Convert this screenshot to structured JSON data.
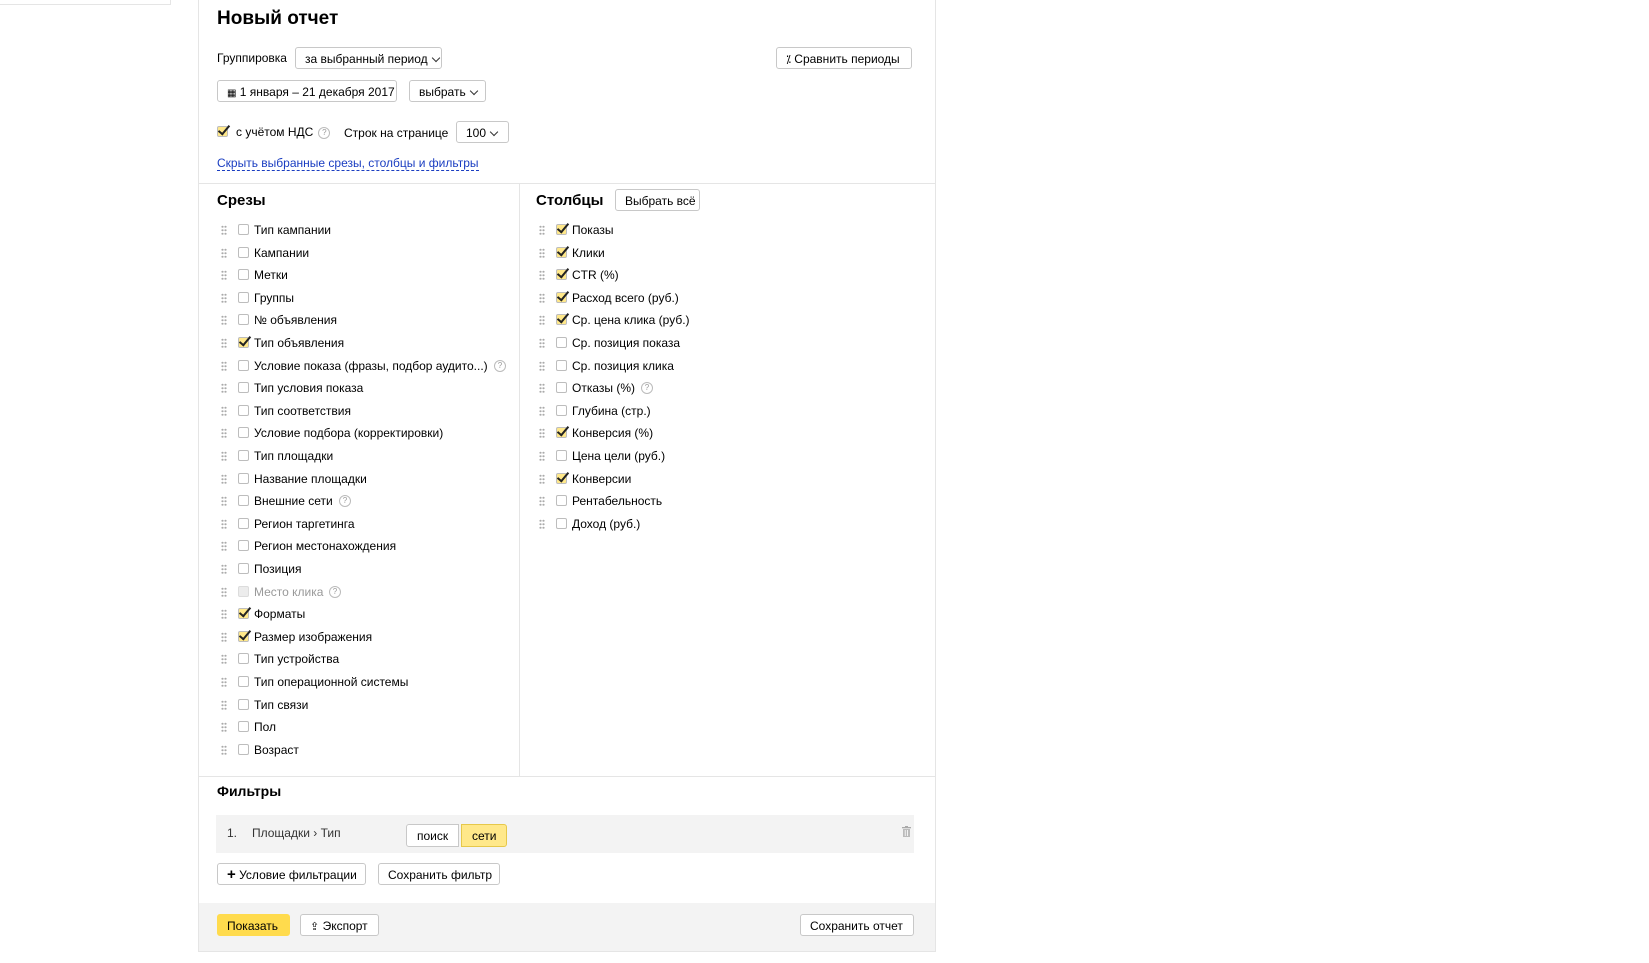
{
  "title": "Новый отчет",
  "grouping": {
    "label": "Группировка",
    "value": "за выбранный период"
  },
  "compare_label": "Сравнить периоды",
  "date_range": "1 января – 21 декабря 2017",
  "choose_label": "выбрать",
  "vat_label": "с учётом НДС",
  "rows_label": "Строк на странице",
  "rows_value": "100",
  "hide_link": "Скрыть выбранные срезы, столбцы и фильтры",
  "slices": {
    "heading": "Срезы",
    "items": [
      {
        "label": "Тип кампании",
        "checked": false
      },
      {
        "label": "Кампании",
        "checked": false
      },
      {
        "label": "Метки",
        "checked": false
      },
      {
        "label": "Группы",
        "checked": false
      },
      {
        "label": "№ объявления",
        "checked": false
      },
      {
        "label": "Тип объявления",
        "checked": true
      },
      {
        "label": "Условие показа (фразы, подбор аудито...)",
        "checked": false,
        "help": true
      },
      {
        "label": "Тип условия показа",
        "checked": false
      },
      {
        "label": "Тип соответствия",
        "checked": false
      },
      {
        "label": "Условие подбора (корректировки)",
        "checked": false
      },
      {
        "label": "Тип площадки",
        "checked": false
      },
      {
        "label": "Название площадки",
        "checked": false
      },
      {
        "label": "Внешние сети",
        "checked": false,
        "help": true
      },
      {
        "label": "Регион таргетинга",
        "checked": false
      },
      {
        "label": "Регион местонахождения",
        "checked": false
      },
      {
        "label": "Позиция",
        "checked": false
      },
      {
        "label": "Место клика",
        "checked": false,
        "disabled": true,
        "help": true
      },
      {
        "label": "Форматы",
        "checked": true
      },
      {
        "label": "Размер изображения",
        "checked": true
      },
      {
        "label": "Тип устройства",
        "checked": false
      },
      {
        "label": "Тип операционной системы",
        "checked": false
      },
      {
        "label": "Тип связи",
        "checked": false
      },
      {
        "label": "Пол",
        "checked": false
      },
      {
        "label": "Возраст",
        "checked": false
      }
    ]
  },
  "columns": {
    "heading": "Столбцы",
    "select_all": "Выбрать всё",
    "items": [
      {
        "label": "Показы",
        "checked": true
      },
      {
        "label": "Клики",
        "checked": true
      },
      {
        "label": "CTR (%)",
        "checked": true
      },
      {
        "label": "Расход всего (руб.)",
        "checked": true
      },
      {
        "label": "Ср. цена клика (руб.)",
        "checked": true
      },
      {
        "label": "Ср. позиция показа",
        "checked": false
      },
      {
        "label": "Ср. позиция клика",
        "checked": false
      },
      {
        "label": "Отказы (%)",
        "checked": false,
        "help": true
      },
      {
        "label": "Глубина (стр.)",
        "checked": false
      },
      {
        "label": "Конверсия (%)",
        "checked": true
      },
      {
        "label": "Цена цели (руб.)",
        "checked": false
      },
      {
        "label": "Конверсии",
        "checked": true
      },
      {
        "label": "Рентабельность",
        "checked": false
      },
      {
        "label": "Доход (руб.)",
        "checked": false
      }
    ]
  },
  "filters": {
    "heading": "Фильтры",
    "row": {
      "num": "1.",
      "field": "Площадки › Тип",
      "options": [
        "поиск",
        "сети"
      ],
      "selected": "сети"
    },
    "add_condition": "Условие фильтрации",
    "save_filter": "Сохранить фильтр"
  },
  "footer": {
    "show": "Показать",
    "export": "Экспорт",
    "save_report": "Сохранить отчет"
  },
  "accent_color": "#ffdb4d"
}
